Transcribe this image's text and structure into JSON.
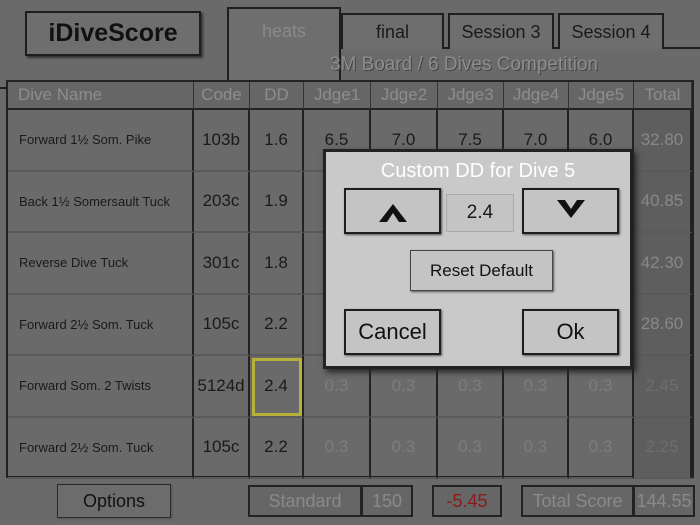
{
  "app": {
    "logo": "iDiveScore"
  },
  "tabs": [
    {
      "label": "heats",
      "active": true
    },
    {
      "label": "final"
    },
    {
      "label": "Session 3"
    },
    {
      "label": "Session 4"
    }
  ],
  "subtitle": "3M Board / 6 Dives Competition",
  "table": {
    "headers": [
      "Dive Name",
      "Code",
      "DD",
      "Jdge1",
      "Jdge2",
      "Jdge3",
      "Jdge4",
      "Jdge5",
      "Total"
    ],
    "rows": [
      {
        "name": "Forward 1½ Som. Pike",
        "code": "103b",
        "dd": "1.6",
        "scores": [
          "6.5",
          "7.0",
          "7.5",
          "7.0",
          "6.0"
        ],
        "total": "32.80"
      },
      {
        "name": "Back 1½ Somersault Tuck",
        "code": "203c",
        "dd": "1.9",
        "scores": [
          "",
          "",
          "",
          "",
          ""
        ],
        "total": "40.85"
      },
      {
        "name": "Reverse Dive Tuck",
        "code": "301c",
        "dd": "1.8",
        "scores": [
          "",
          "",
          "",
          "",
          ""
        ],
        "total": "42.30"
      },
      {
        "name": "Forward 2½ Som. Tuck",
        "code": "105c",
        "dd": "2.2",
        "scores": [
          "",
          "",
          "",
          "",
          ""
        ],
        "total": "28.60"
      },
      {
        "name": "Forward Som. 2 Twists",
        "code": "5124d",
        "dd": "2.4",
        "scores": [
          "0.3",
          "0.3",
          "0.3",
          "0.3",
          "0.3"
        ],
        "total": "2.45"
      },
      {
        "name": "Forward 2½ Som. Tuck",
        "code": "105c",
        "dd": "2.2",
        "scores": [
          "0.3",
          "0.3",
          "0.3",
          "0.3",
          "0.3"
        ],
        "total": "2.25"
      }
    ]
  },
  "dialog": {
    "title": "Custom DD for Dive 5",
    "value": "2.4",
    "reset": "Reset Default",
    "cancel": "Cancel",
    "ok": "Ok"
  },
  "footer": {
    "options": "Options",
    "standard_label": "Standard",
    "standard_value": "150",
    "diff": "-5.45",
    "total_label": "Total Score",
    "total_value": "144.55"
  },
  "colors": {
    "diff": "#8b1a1a",
    "highlight": "#b8b03a"
  }
}
